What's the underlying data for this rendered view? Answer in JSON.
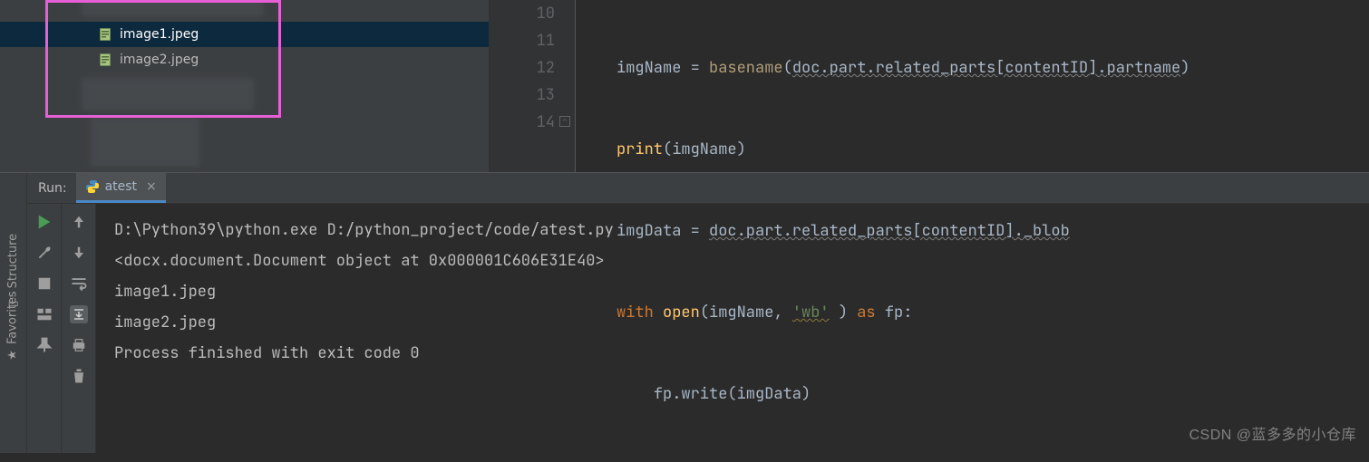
{
  "tree": {
    "items": [
      {
        "name": "image1.jpeg",
        "selected": true
      },
      {
        "name": "image2.jpeg",
        "selected": false
      }
    ]
  },
  "editor": {
    "lines": {
      "n10": "10",
      "n11": "11",
      "n12": "12",
      "n13": "13",
      "n14": "14"
    },
    "code": {
      "l10_a": "imgName = ",
      "l10_b": "basename",
      "l10_c": "(",
      "l10_d": "doc.part.related_parts[contentID].partname",
      "l10_e": ")",
      "l11_a": "print",
      "l11_b": "(imgName)",
      "l12_a": "imgData = ",
      "l12_b": "doc.part.related_parts[contentID]._blob",
      "l13_a": "with ",
      "l13_b": "open",
      "l13_c": "(imgName, ",
      "l13_d": "'wb'",
      "l13_e": " ) ",
      "l13_f": "as ",
      "l13_g": "fp:",
      "l14_a": "fp.write(imgData)"
    }
  },
  "run": {
    "label": "Run:",
    "tab": "atest",
    "output": {
      "l1": "D:\\Python39\\python.exe D:/python_project/code/atest.py",
      "l2": "<docx.document.Document object at 0x000001C606E31E40>",
      "l3": "image1.jpeg",
      "l4": "image2.jpeg",
      "l5": "",
      "l6": "Process finished with exit code 0"
    }
  },
  "sidebar": {
    "structure": "Structure",
    "favorites": "Favorites"
  },
  "watermark": "CSDN @蓝多多的小仓库"
}
